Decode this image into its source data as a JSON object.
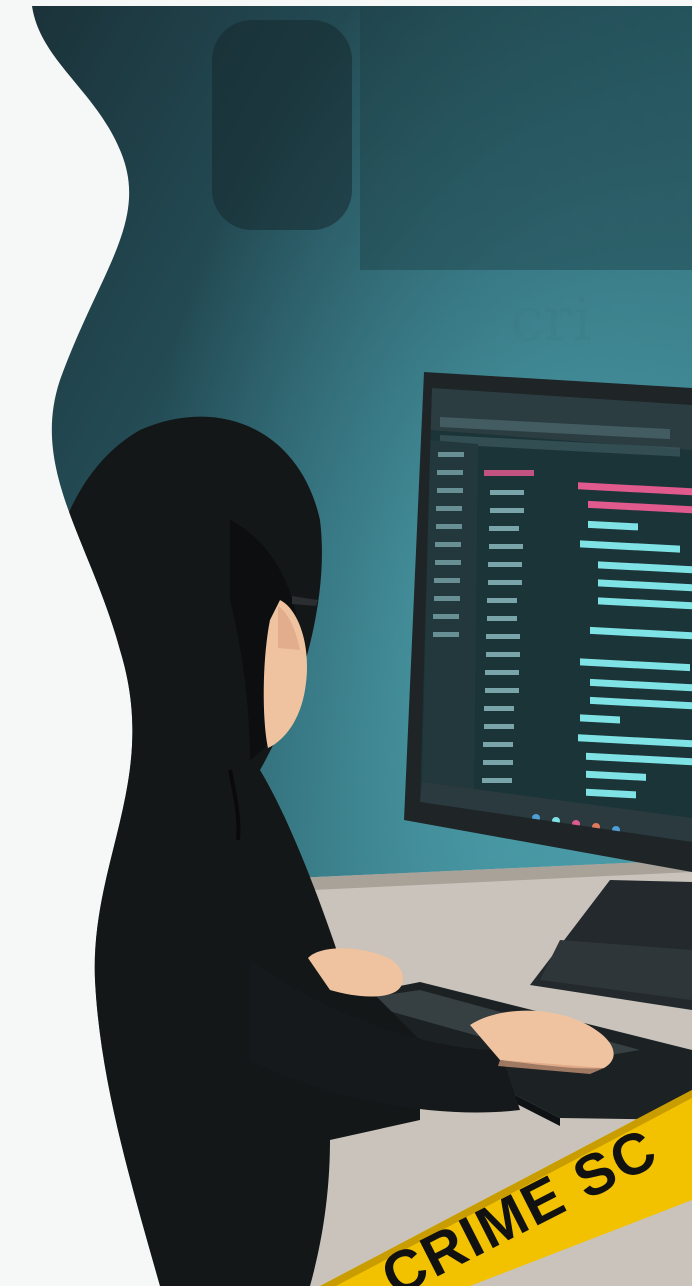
{
  "scene": {
    "caution_tape_text": "CRIME SC",
    "colors": {
      "page_bg": "#f6f7f7",
      "wall_dark": "#1d3a42",
      "wall_light": "#3f8c9a",
      "hood": "#141718",
      "skin": "#f0c3a0",
      "desk": "#c9c3bb",
      "monitor_frame": "#1f2427",
      "screen_bg": "#1b3438",
      "code_pink": "#e05a8e",
      "code_cyan": "#7fe3e6",
      "tape_yellow": "#f2c200"
    }
  }
}
